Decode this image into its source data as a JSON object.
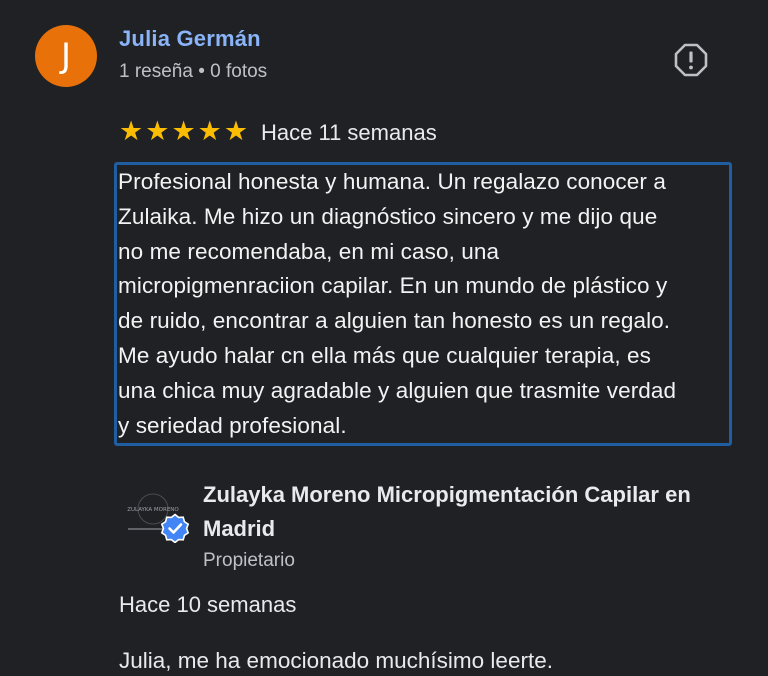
{
  "reviewer": {
    "initial": "J",
    "name": "Julia Germán",
    "meta": "1 reseña • 0 fotos",
    "avatar_color": "#e8710a"
  },
  "review": {
    "rating": 5,
    "stars": [
      "★",
      "★",
      "★",
      "★",
      "★"
    ],
    "date": "Hace 11 semanas",
    "lines": [
      "Profesional honesta y humana. Un regalazo conocer a",
      "Zulaika. Me hizo un diagnóstico sincero y me dijo que",
      "no me recomendaba, en mi caso, una",
      "micropigmenraciion capilar. En un mundo de plástico y",
      "de ruido, encontrar a alguien tan honesto es un regalo.",
      "Me ayudo halar cn ella más que cualquier terapia, es",
      "una chica muy agradable y alguien que trasmite verdad",
      "y seriedad profesional."
    ]
  },
  "owner_reply": {
    "name": "Zulayka Moreno Micropigmentación Capilar en Madrid",
    "role": "Propietario",
    "date": "Hace 10 semanas",
    "text": "Julia, me ha emocionado muchísimo leerte.",
    "logo_text": "ZULAYKA MORENO"
  },
  "icons": {
    "report": "report-flag-icon",
    "verified": "verified-badge-icon",
    "star": "star-icon"
  },
  "colors": {
    "background": "#202124",
    "link_name": "#8ab4f8",
    "star": "#fbbc04",
    "highlight_border": "#1f5ea0",
    "verified": "#4285f4"
  }
}
